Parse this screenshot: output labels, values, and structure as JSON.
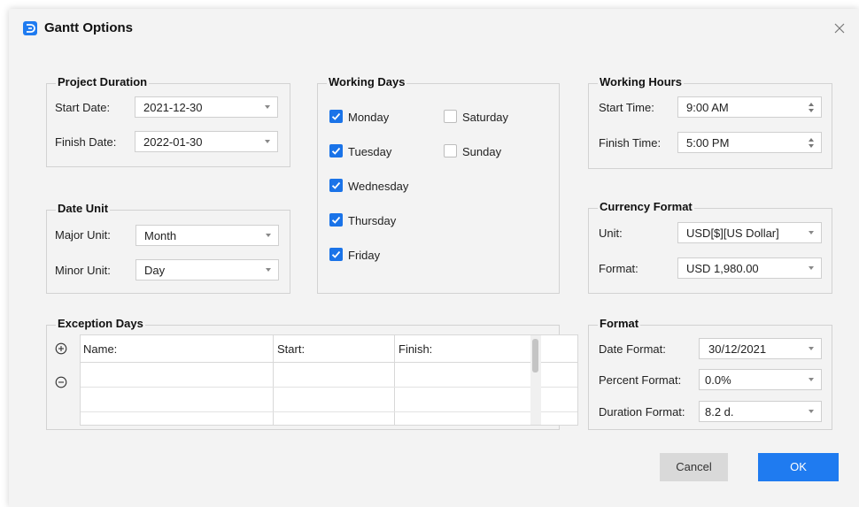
{
  "window": {
    "title": "Gantt Options",
    "close_glyph": "×",
    "accent": "#1f7bf0"
  },
  "project_duration": {
    "title": "Project Duration",
    "start_label": "Start Date:",
    "start_value": "2021-12-30",
    "finish_label": "Finish Date:",
    "finish_value": "2022-01-30"
  },
  "date_unit": {
    "title": "Date Unit",
    "major_label": "Major Unit:",
    "major_value": "Month",
    "minor_label": "Minor Unit:",
    "minor_value": "Day"
  },
  "working_days": {
    "title": "Working Days",
    "days": [
      {
        "label": "Monday",
        "checked": true
      },
      {
        "label": "Tuesday",
        "checked": true
      },
      {
        "label": "Wednesday",
        "checked": true
      },
      {
        "label": "Thursday",
        "checked": true
      },
      {
        "label": "Friday",
        "checked": true
      },
      {
        "label": "Saturday",
        "checked": false
      },
      {
        "label": "Sunday",
        "checked": false
      }
    ]
  },
  "working_hours": {
    "title": "Working Hours",
    "start_label": "Start Time:",
    "start_value": "9:00 AM",
    "finish_label": "Finish Time:",
    "finish_value": "5:00 PM"
  },
  "currency_format": {
    "title": "Currency Format",
    "unit_label": "Unit:",
    "unit_value": "USD[$][US Dollar]",
    "format_label": "Format:",
    "format_value": "USD 1,980.00"
  },
  "exception_days": {
    "title": "Exception Days",
    "columns": [
      "Name:",
      "Start:",
      "Finish:"
    ],
    "add_icon": "plus-circle-icon",
    "remove_icon": "minus-circle-icon"
  },
  "format": {
    "title": "Format",
    "date_label": "Date Format:",
    "date_value": "30/12/2021",
    "percent_label": "Percent Format:",
    "percent_value": "0.0%",
    "duration_label": "Duration Format:",
    "duration_value": "8.2 d."
  },
  "buttons": {
    "cancel": "Cancel",
    "ok": "OK"
  }
}
